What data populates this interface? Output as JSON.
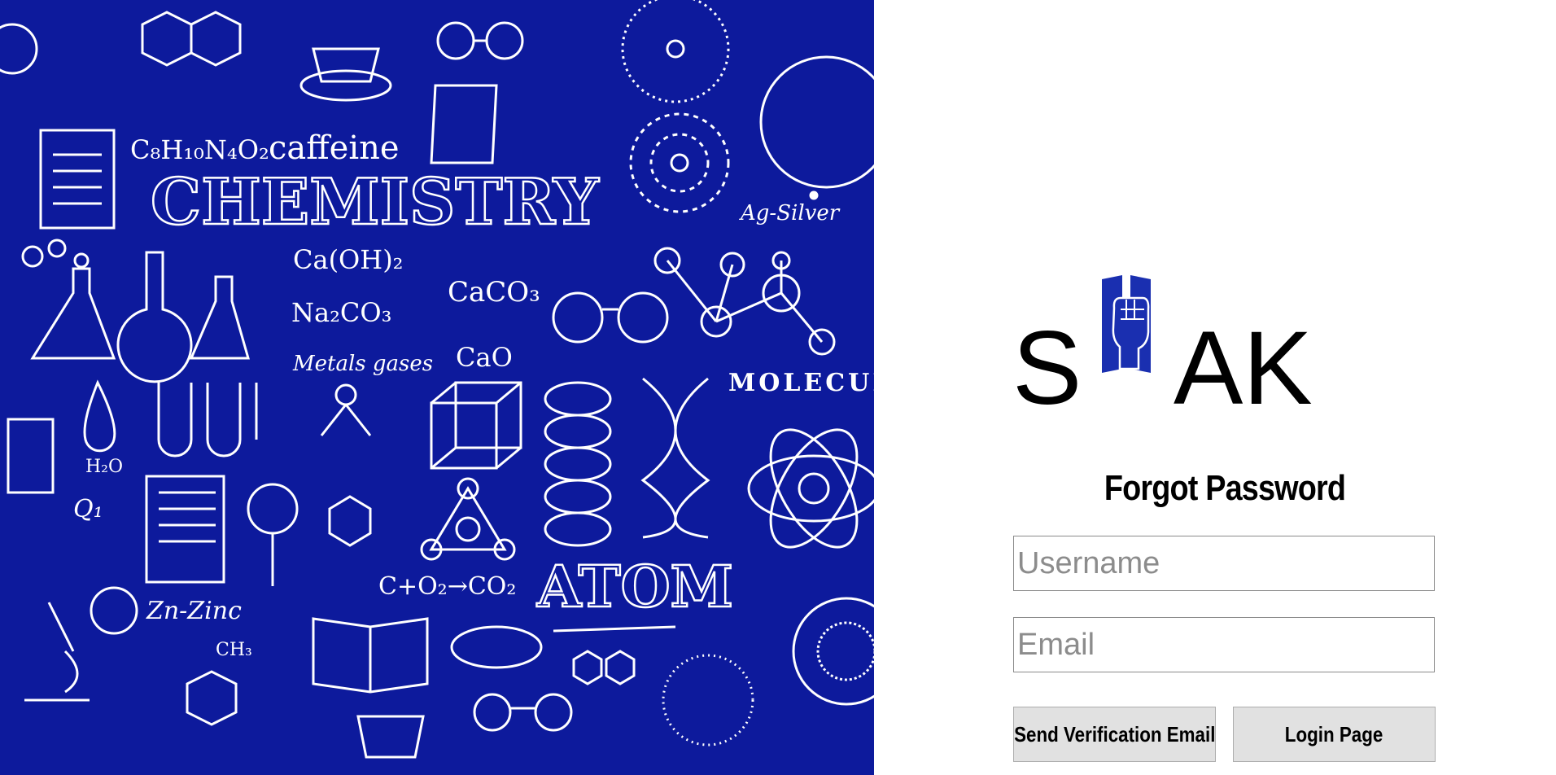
{
  "left_art": {
    "title_word": "CHEMISTRY",
    "atom_word": "ATOM",
    "molecule_word": "MOLECUL",
    "caffeine": "caffeine",
    "caffeine_formula": "C₈H₁₀N₄O₂",
    "silver": "Ag-Silver",
    "zinc": "Zn-Zinc",
    "metals_gases": "Metals gases",
    "reaction_1": "Ca(OH)₂",
    "reaction_2": "Na₂CO₃",
    "reaction_3": "CaCO₃",
    "reaction_4": "CaO",
    "combustion": "C+O₂→CO₂",
    "water": "H₂O",
    "q1": "Q₁",
    "ch3": "CH₃",
    "bg_color": "#0d1a9c"
  },
  "logo": {
    "letter_1": "S",
    "letter_2": "AK",
    "emblem_color": "#1a2fb0"
  },
  "form": {
    "title": "Forgot Password",
    "username_placeholder": "Username",
    "email_placeholder": "Email",
    "send_button": "Send Verification Email",
    "login_button": "Login Page"
  }
}
